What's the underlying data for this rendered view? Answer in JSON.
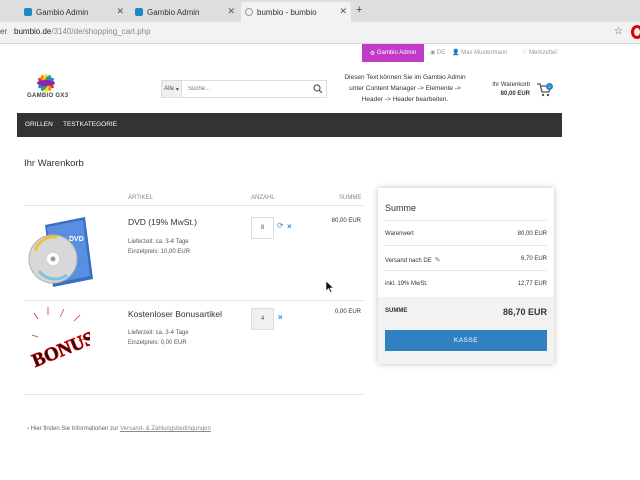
{
  "browser": {
    "tabs": [
      {
        "title": "Gambio Admin",
        "favicon_color": "#1e88c7"
      },
      {
        "title": "Gambio Admin",
        "favicon_color": "#1e88c7"
      },
      {
        "title": "bumbio - bumbio",
        "favicon_color": "#999999"
      }
    ],
    "new_tab": "+",
    "url_left": "er",
    "url_host": "bumbio.de",
    "url_path": "/3140/de/shopping_cart.php"
  },
  "adminbar": {
    "admin_button": "Gambio Admin",
    "language": "DE",
    "user": "Max Mustermann",
    "wishlist": "Merkzettel"
  },
  "header": {
    "logo_text": "GAMBIO GX3",
    "search_category": "Alle",
    "search_placeholder": "Suche...",
    "note": "Diesen Text können Sie im Gambio Admin unter Content Manager -> Elemente -> Header -> Header bearbeiten.",
    "cart_label": "Ihr Warenkorb",
    "cart_total": "80,00 EUR",
    "cart_count": "2"
  },
  "nav": {
    "items": [
      "GRILLEN",
      "TESTKATEGORIE"
    ]
  },
  "page": {
    "title": "Ihr Warenkorb"
  },
  "cart": {
    "headers": {
      "article": "ARTIKEL",
      "quantity": "ANZAHL",
      "sum": "SUMME"
    },
    "items": [
      {
        "name": "DVD (19% MwSt.)",
        "delivery": "Lieferzeit: ca. 3-4 Tage",
        "unit_price": "Einzelpreis: 10,00 EUR",
        "quantity": "8",
        "sum": "80,00 EUR"
      },
      {
        "name": "Kostenloser Bonusartikel",
        "delivery": "Lieferzeit: ca. 3-4 Tage",
        "unit_price": "Einzelpreis: 0,00 EUR",
        "quantity": "4",
        "sum": "0,00 EUR"
      }
    ],
    "info_prefix": "Hier finden Sie Informationen zur",
    "info_link": "Versand- & Zahlungsbedingungen"
  },
  "summary": {
    "title": "Summe",
    "rows": [
      {
        "label": "Warenwert",
        "value": "80,00 EUR"
      },
      {
        "label": "Versand nach DE",
        "value": "6,70 EUR"
      },
      {
        "label": "inkl. 19% MwSt.",
        "value": "12,77 EUR"
      }
    ],
    "total_label": "SUMME",
    "total_value": "86,70 EUR",
    "checkout_label": "KASSE"
  },
  "colors": {
    "admin_accent": "#c13ac8",
    "nav_background": "#333333",
    "checkout_blue": "#3180c2"
  }
}
